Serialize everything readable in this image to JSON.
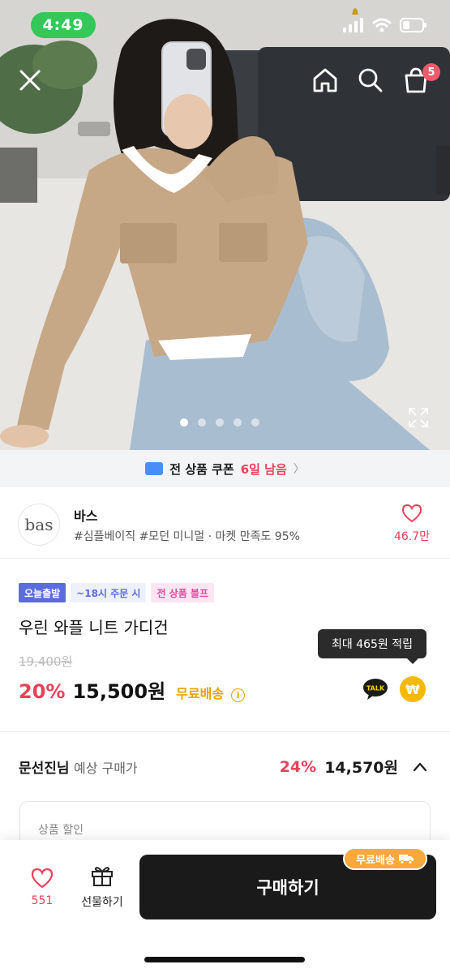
{
  "status_bar": {
    "time": "4:49"
  },
  "header": {
    "cart_count": "5"
  },
  "gallery": {
    "total_images": 5,
    "active_index": 1
  },
  "coupon": {
    "text": "전 상품 쿠폰",
    "days_left": "6일 남음"
  },
  "store": {
    "logo_text": "bas",
    "name": "바스",
    "tags": "#심플베이직 #모던 미니멀 · 마켓 만족도 95%",
    "like_count": "46.7만"
  },
  "product": {
    "badges": [
      "오늘출발",
      "~18시 주문 시",
      "전 상품 블프"
    ],
    "title": "우린 와플 니트 가디건",
    "original_price": "19,400원",
    "discount": "20%",
    "price": "15,500원",
    "free_shipping": "무료배송",
    "tooltip": "최대 465원 적립",
    "talk_label": "TALK",
    "point_symbol": "₩"
  },
  "expected": {
    "name": "문선진님",
    "label": "예상 구매가",
    "discount": "24%",
    "price": "14,570원"
  },
  "detail": {
    "label": "상품 할인"
  },
  "bottom": {
    "like_count": "551",
    "gift_label": "선물하기",
    "buy_label": "구매하기",
    "free_ship_chip": "무료배송"
  },
  "colors": {
    "accent": "#e8425a",
    "primary_button": "#1a1a1a",
    "free_ship": "#e8a200"
  },
  "icons": [
    "close-icon",
    "home-icon",
    "search-icon",
    "cart-icon",
    "expand-icon",
    "heart-icon",
    "gift-icon",
    "truck-icon",
    "chevron-up-icon",
    "info-icon"
  ]
}
